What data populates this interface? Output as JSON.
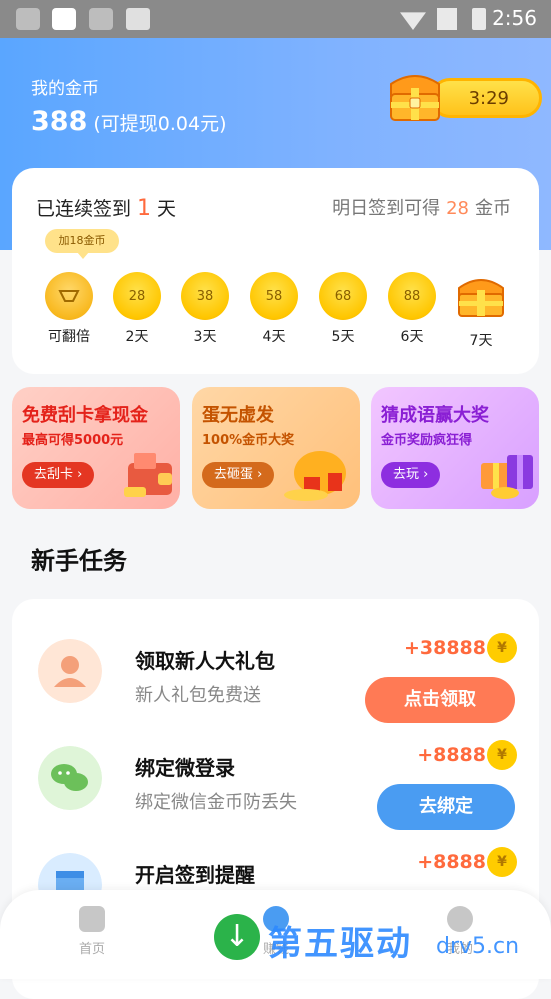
{
  "status_bar": {
    "time": "2:56"
  },
  "header": {
    "coin_label": "我的金币",
    "coin_amount": "388",
    "withdrawable": "(可提现0.04元)",
    "chest_timer": "3:29"
  },
  "signin": {
    "prefix": "已连续签到",
    "days": "1",
    "suffix": "天",
    "tomorrow_prefix": "明日签到可得",
    "tomorrow_value": "28",
    "tomorrow_suffix": "金币",
    "tooltip": "加18金币",
    "days_list": [
      {
        "coin": "",
        "label": "可翻倍"
      },
      {
        "coin": "28",
        "label": "2天"
      },
      {
        "coin": "38",
        "label": "3天"
      },
      {
        "coin": "58",
        "label": "4天"
      },
      {
        "coin": "68",
        "label": "5天"
      },
      {
        "coin": "88",
        "label": "6天"
      },
      {
        "coin": "",
        "label": "7天"
      }
    ]
  },
  "promos": [
    {
      "title": "免费刮卡拿现金",
      "subtitle": "最高可得5000元",
      "button": "去刮卡 ›"
    },
    {
      "title": "蛋无虚发",
      "subtitle": "100%金币大奖",
      "button": "去砸蛋 ›"
    },
    {
      "title": "猜成语赢大奖",
      "subtitle": "金币奖励疯狂得",
      "button": "去玩 ›"
    }
  ],
  "tasks_section": {
    "title": "新手任务",
    "tasks": [
      {
        "title": "领取新人大礼包",
        "desc": "新人礼包免费送",
        "reward": "+38888",
        "coin": "¥",
        "action": "点击领取"
      },
      {
        "title": "绑定微登录",
        "desc": "绑定微信金币防丢失",
        "reward": "+8888",
        "coin": "¥",
        "action": "去绑定"
      },
      {
        "title": "开启签到提醒",
        "desc": "",
        "reward": "+8888",
        "coin": "¥",
        "action": ""
      }
    ]
  },
  "bottom_nav": [
    {
      "label": "首页"
    },
    {
      "label": "赚钱"
    },
    {
      "label": "我的"
    }
  ],
  "watermark": {
    "text": "第五驱动",
    "url": "drv5.cn"
  }
}
